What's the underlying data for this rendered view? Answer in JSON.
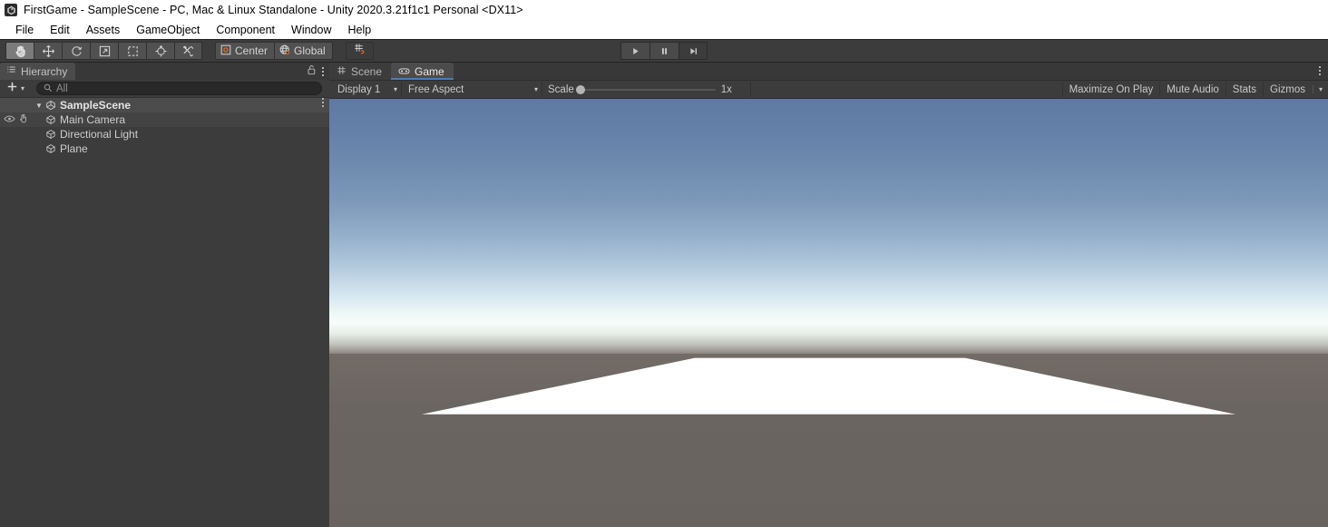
{
  "window": {
    "title": "FirstGame - SampleScene - PC, Mac & Linux Standalone - Unity 2020.3.21f1c1 Personal <DX11>",
    "app_icon": "unity-logo-icon"
  },
  "menubar": {
    "items": [
      {
        "label": "File"
      },
      {
        "label": "Edit"
      },
      {
        "label": "Assets"
      },
      {
        "label": "GameObject"
      },
      {
        "label": "Component"
      },
      {
        "label": "Window"
      },
      {
        "label": "Help"
      }
    ]
  },
  "toolbar": {
    "transform_tools": [
      {
        "name": "hand-tool",
        "icon": "hand-icon",
        "active": true
      },
      {
        "name": "move-tool",
        "icon": "move-arrows-icon",
        "active": false
      },
      {
        "name": "rotate-tool",
        "icon": "rotate-icon",
        "active": false
      },
      {
        "name": "scale-tool",
        "icon": "scale-icon",
        "active": false
      },
      {
        "name": "rect-tool",
        "icon": "rect-transform-icon",
        "active": false
      },
      {
        "name": "transform-tool",
        "icon": "transform-icon",
        "active": false
      },
      {
        "name": "custom-editor-tool",
        "icon": "wrench-screwdriver-icon",
        "active": false
      }
    ],
    "pivot_label": "Center",
    "pivot_icon": "pivot-center-icon",
    "handle_label": "Global",
    "handle_icon": "globe-icon",
    "snap_icon": "grid-snap-icon",
    "play_controls": [
      {
        "name": "play-button",
        "icon": "play-icon"
      },
      {
        "name": "pause-button",
        "icon": "pause-icon"
      },
      {
        "name": "step-button",
        "icon": "step-forward-icon"
      }
    ]
  },
  "hierarchy": {
    "tab_label": "Hierarchy",
    "tab_icon": "hierarchy-icon",
    "lock_icon": "lock-open-icon",
    "menu_icon": "kebab-menu-icon",
    "add_label": "+",
    "add_icon": "plus-icon",
    "add_caret": "▾",
    "search": {
      "placeholder": "All",
      "value": "",
      "icon": "search-icon"
    },
    "scene": {
      "label": "SampleScene",
      "icon": "unity-scene-icon",
      "foldout": "▼",
      "menu_icon": "kebab-menu-icon"
    },
    "objects": [
      {
        "label": "Main Camera",
        "icon": "gameobject-cube-icon",
        "hovered": true,
        "visibility_icon": "eye-icon",
        "pickability_icon": "hand-pointer-icon"
      },
      {
        "label": "Directional Light",
        "icon": "gameobject-cube-icon",
        "hovered": false
      },
      {
        "label": "Plane",
        "icon": "gameobject-cube-icon",
        "hovered": false
      }
    ]
  },
  "game_view": {
    "tabs": [
      {
        "label": "Scene",
        "icon": "scene-grid-icon",
        "active": false
      },
      {
        "label": "Game",
        "icon": "gamepad-icon",
        "active": true
      }
    ],
    "panel_menu_icon": "kebab-menu-icon",
    "display": {
      "label": "Display 1",
      "caret": "▾"
    },
    "aspect": {
      "label": "Free Aspect",
      "caret": "▾"
    },
    "scale": {
      "label": "Scale",
      "value": "1x",
      "position_percent": 0
    },
    "right_controls": [
      {
        "label": "Maximize On Play",
        "name": "maximize-on-play-toggle"
      },
      {
        "label": "Mute Audio",
        "name": "mute-audio-toggle"
      },
      {
        "label": "Stats",
        "name": "stats-toggle"
      },
      {
        "label": "Gizmos",
        "name": "gizmos-toggle",
        "caret": "▾"
      }
    ]
  },
  "render": {
    "sky_top_color": "#5e79a3",
    "sky_horizon_color": "#f7fdfa",
    "ground_color": "#6a6461",
    "plane_color": "#ffffff",
    "plane_points": "403,285 701,285 999,347 102,347"
  }
}
